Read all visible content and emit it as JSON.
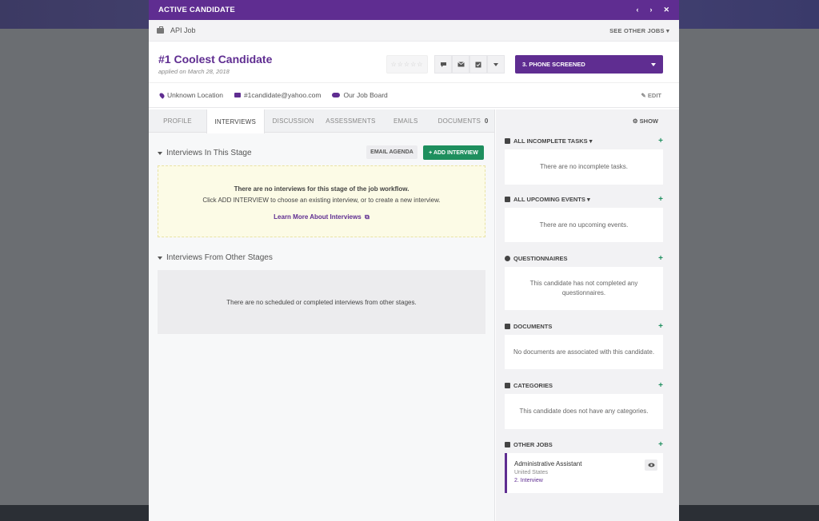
{
  "modal": {
    "title": "ACTIVE CANDIDATE",
    "nav_prev": "‹",
    "nav_next": "›",
    "close": "✕"
  },
  "job": {
    "name": "API Job",
    "see_other": "SEE OTHER JOBS ▾"
  },
  "candidate": {
    "name": "#1 Coolest Candidate",
    "applied": "applied on March 28, 2018",
    "stars": "☆☆☆☆☆",
    "stage": "3. PHONE SCREENED",
    "location": "Unknown Location",
    "email": "#1candidate@yahoo.com",
    "source": "Our Job Board",
    "edit": "EDIT"
  },
  "toolbar_icons": [
    "comment-icon",
    "mail-icon",
    "checkbox-icon",
    "caret-down-icon"
  ],
  "tabs": [
    {
      "label": "PROFILE"
    },
    {
      "label": "INTERVIEWS"
    },
    {
      "label": "DISCUSSION"
    },
    {
      "label": "ASSESSMENTS"
    },
    {
      "label": "EMAILS"
    },
    {
      "label": "DOCUMENTS",
      "count": "0"
    }
  ],
  "interviews": {
    "stage_title": "Interviews In This Stage",
    "email_agenda": "EMAIL AGENDA",
    "add_interview": "+ ADD INTERVIEW",
    "empty_line1": "There are no interviews for this stage of the job workflow.",
    "empty_line2": "Click ADD INTERVIEW to choose an existing interview, or to create a new interview.",
    "learn_more": "Learn More About Interviews",
    "other_title": "Interviews From Other Stages",
    "other_empty": "There are no scheduled or completed interviews from other stages."
  },
  "sidebar": {
    "show": "SHOW",
    "sections": [
      {
        "title": "ALL INCOMPLETE TASKS ▾",
        "body": "There are no incomplete tasks."
      },
      {
        "title": "ALL UPCOMING EVENTS ▾",
        "body": "There are no upcoming events."
      },
      {
        "title": "QUESTIONNAIRES",
        "body": "This candidate has not completed any questionnaires."
      },
      {
        "title": "DOCUMENTS",
        "body": "No documents are associated with this candidate."
      },
      {
        "title": "CATEGORIES",
        "body": "This candidate does not have any categories."
      },
      {
        "title": "OTHER JOBS"
      }
    ],
    "other_job": {
      "title": "Administrative Assistant",
      "location": "United States",
      "stage": "2. Interview"
    }
  },
  "colors": {
    "brand": "#5f2d91",
    "success": "#1e8f5e"
  }
}
